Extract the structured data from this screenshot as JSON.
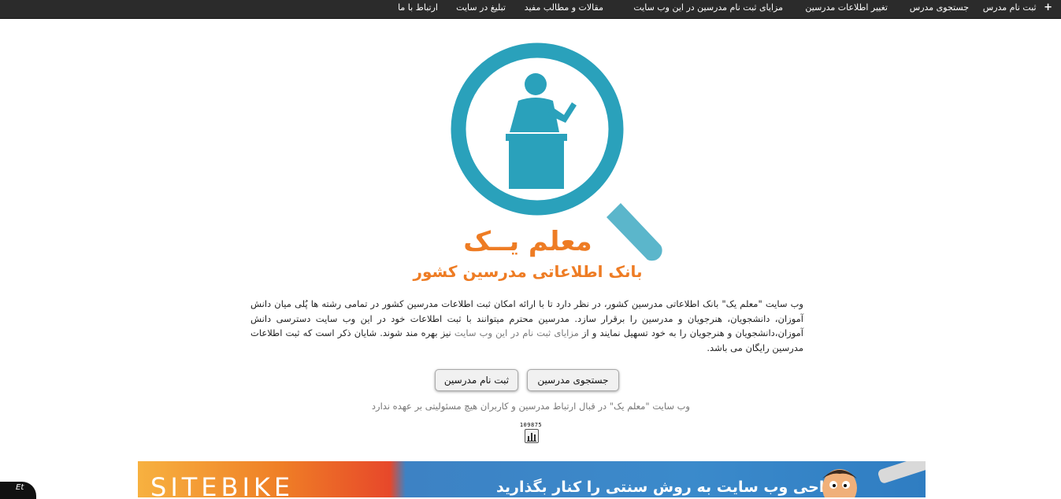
{
  "nav": {
    "register_teacher": "ثبت نام مدرس",
    "search_teacher": "جستجوی مدرس",
    "change_info": "تغییر اطلاعات مدرسین",
    "benefits": "مزایای ثبت نام  مدرسین در این وب سایت",
    "articles": "مقالات و مطالب مفید",
    "advertise": "تبلیغ در سایت",
    "contact": "ارتباط با ما"
  },
  "logo": {
    "title": "معلم یــک",
    "subtitle": "بانک اطلاعاتی مدرسین کشور",
    "colors": {
      "teal": "#2aa1bb",
      "orange": "#ee7c24"
    }
  },
  "intro": {
    "lead": "وب سایت \"معلم یک\" بانک اطلاعاتی مدرسین کشور، در نظر دارد تا با ارائه امکان ثبت اطلاعات مدرسین کشور در تمامی رشته ها  پُلی میان دانش آموزان، دانشجویان، هنرجویان و مدرسین را برقرار سازد. مدرسین محترم میتوانند با ثبت اطلاعات خود در این وب سایت دسترسی دانش آموزان،دانشجویان و هنرجویان را به خود تسهیل نمایند و از",
    "highlight": "مزایای ثبت نام در این وب سایت",
    "tail": "نیز بهره مند شوند. شایان ذکر است که ثبت اطلاعات مدرسین رایگان می باشد."
  },
  "buttons": {
    "search": "جستجوی مدرسین",
    "register": "ثبت نام مدرسین"
  },
  "disclaimer": "وب سایت \"معلم یک\" در قبال ارتباط مدرسین و کاربران هیچ مسئولیتی بر عهده ندارد",
  "counter": {
    "value": "109875",
    "icon": "bar-chart-icon"
  },
  "banner": {
    "brand": "SITEBIKE",
    "slogan": "طراحی وب سایت به روش سنتی را کنار بگذارید"
  },
  "corner_badge": {
    "label": "Et"
  }
}
